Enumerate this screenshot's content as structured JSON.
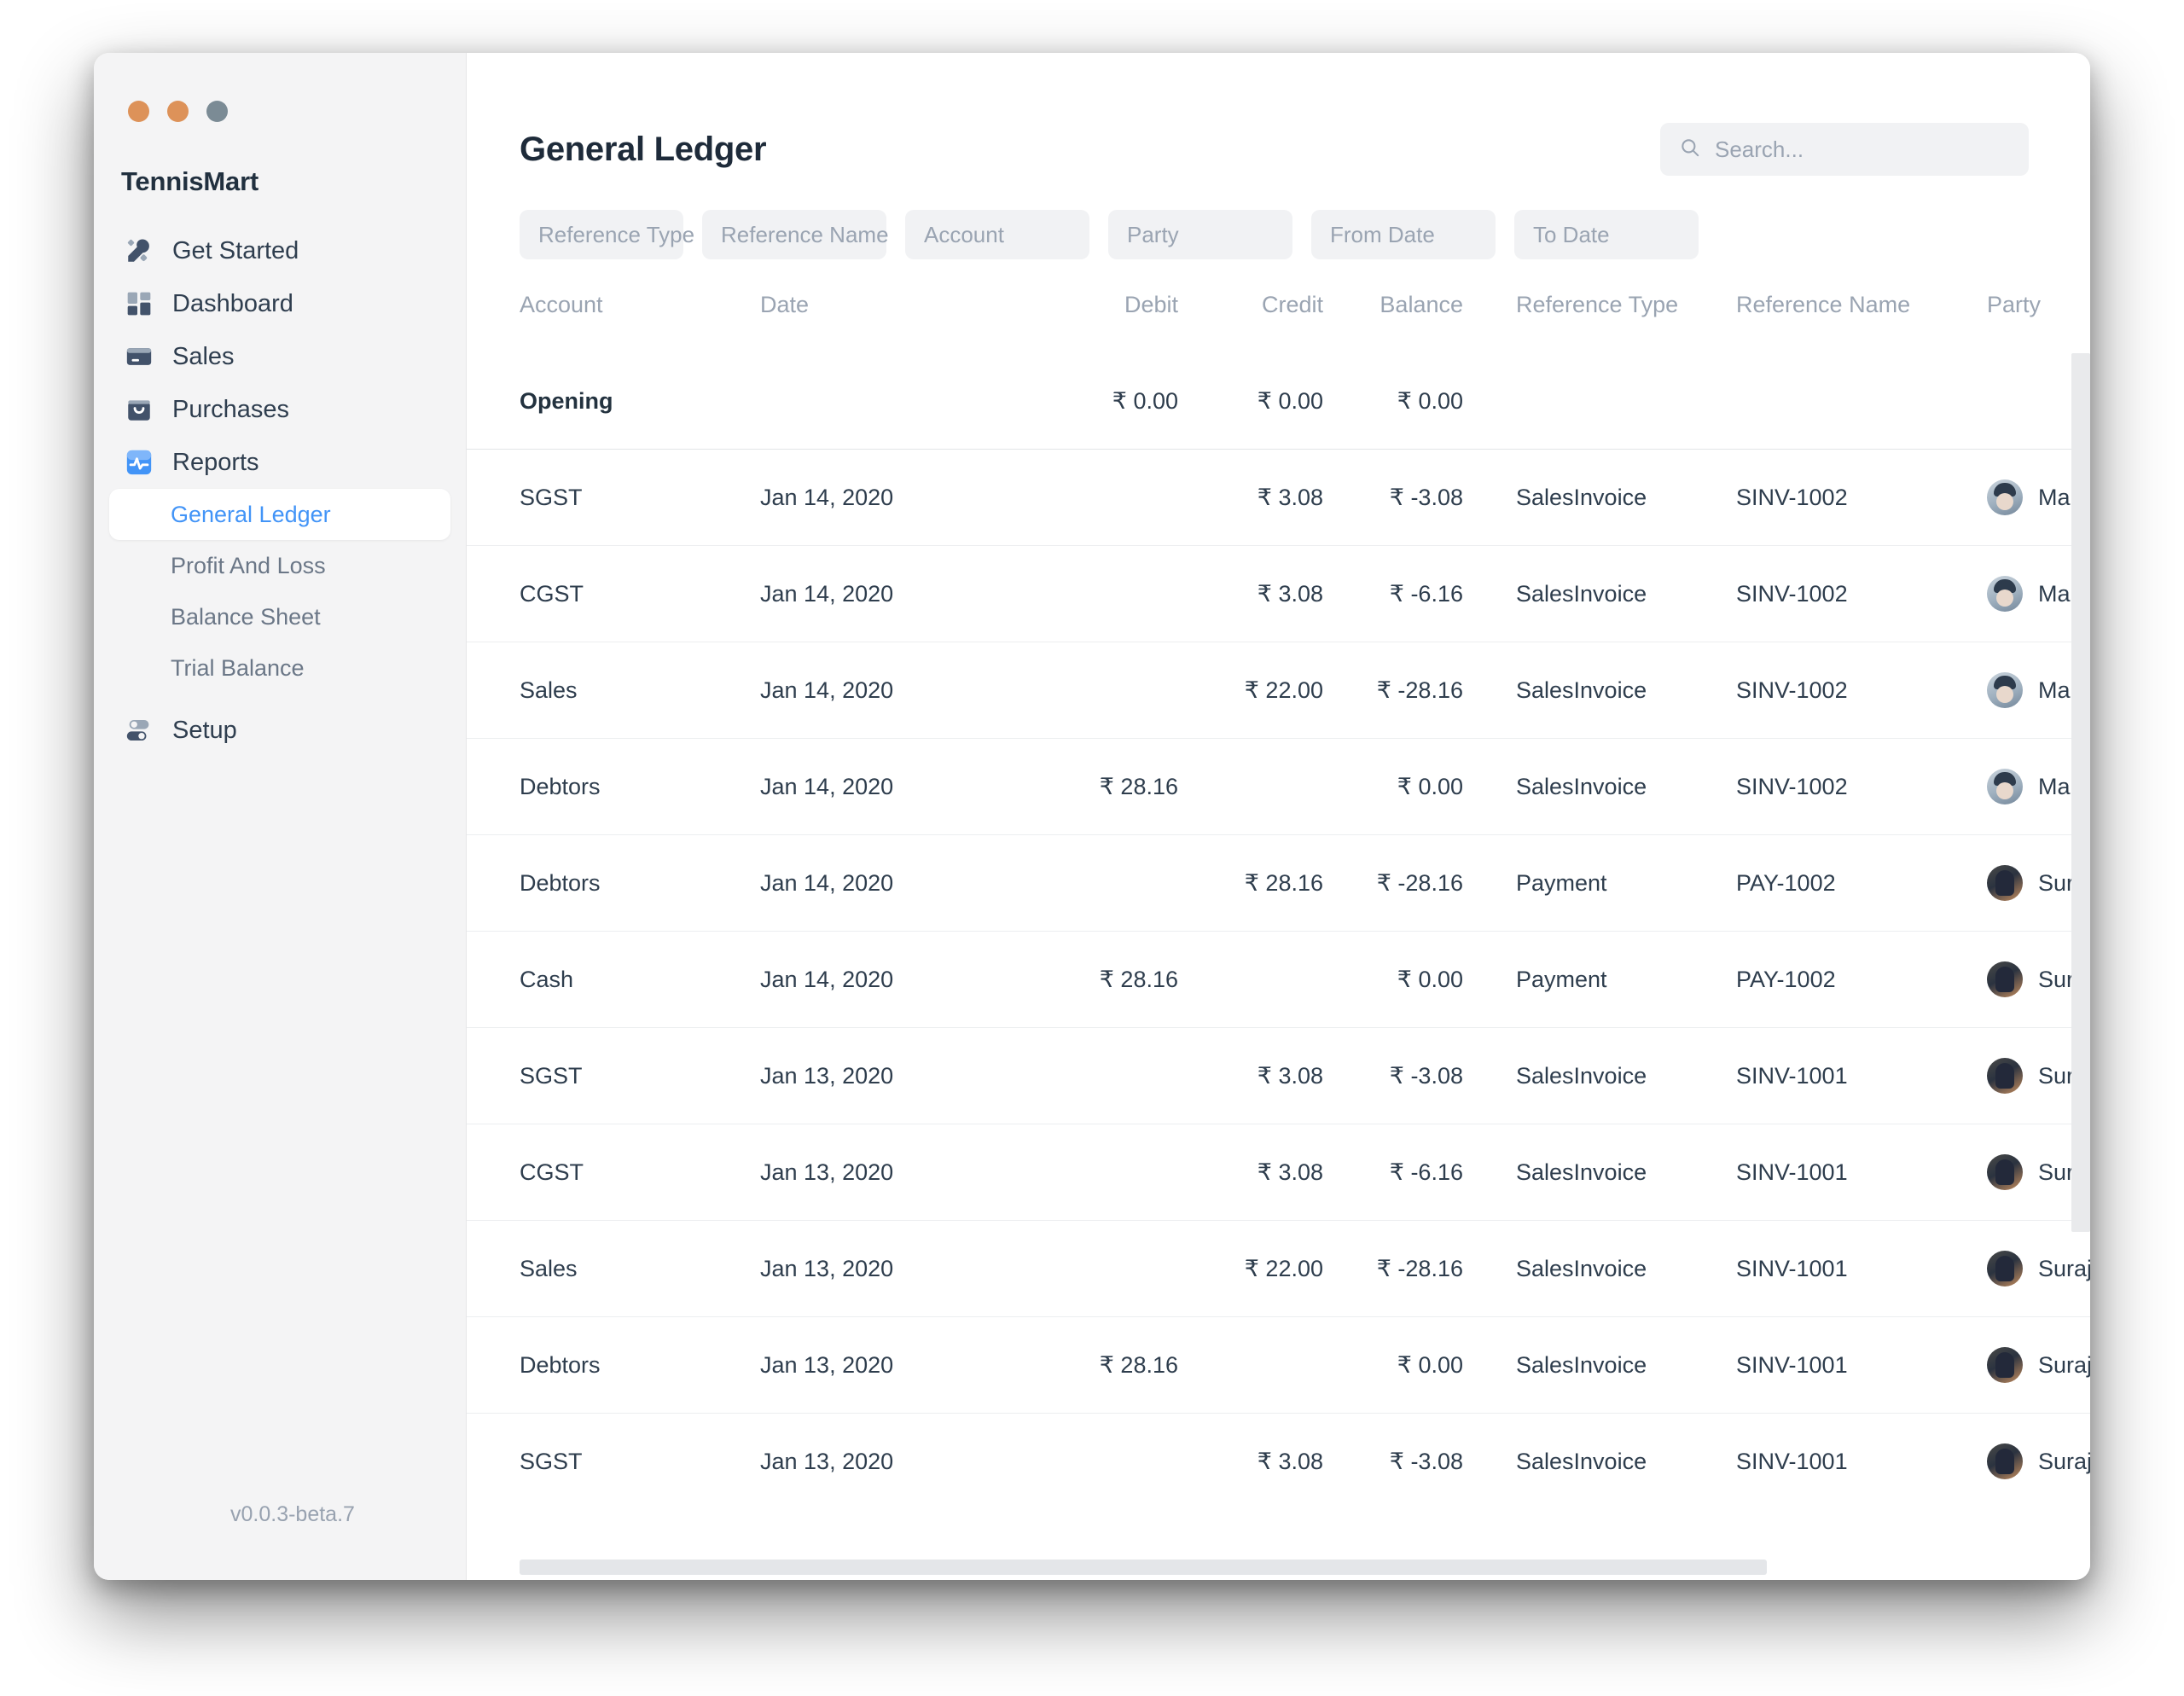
{
  "window": {
    "traffic_lights": [
      "close",
      "minimize",
      "zoom"
    ],
    "colors": {
      "close": "#dd9259",
      "minimize": "#dd9259",
      "zoom": "#7b8b95",
      "accent": "#4294f7"
    }
  },
  "sidebar": {
    "company": "TennisMart",
    "version": "v0.0.3-beta.7",
    "items": [
      {
        "label": "Get Started",
        "icon": "tools-icon"
      },
      {
        "label": "Dashboard",
        "icon": "dashboard-grid-icon"
      },
      {
        "label": "Sales",
        "icon": "card-icon"
      },
      {
        "label": "Purchases",
        "icon": "shopping-bag-icon"
      },
      {
        "label": "Reports",
        "icon": "chart-activity-icon"
      }
    ],
    "reports_children": [
      {
        "label": "General Ledger",
        "active": true
      },
      {
        "label": "Profit And Loss",
        "active": false
      },
      {
        "label": "Balance Sheet",
        "active": false
      },
      {
        "label": "Trial Balance",
        "active": false
      }
    ],
    "setup": {
      "label": "Setup",
      "icon": "toggles-icon"
    }
  },
  "header": {
    "title": "General Ledger",
    "search": {
      "placeholder": "Search...",
      "value": "",
      "icon": "search-icon"
    }
  },
  "filters": [
    {
      "label": "Reference Type",
      "type": "select",
      "has_chevron": true
    },
    {
      "label": "Reference Name",
      "type": "text",
      "has_chevron": false
    },
    {
      "label": "Account",
      "type": "text",
      "has_chevron": false
    },
    {
      "label": "Party",
      "type": "text",
      "has_chevron": false
    },
    {
      "label": "From Date",
      "type": "date",
      "has_chevron": false
    },
    {
      "label": "To Date",
      "type": "date",
      "has_chevron": false
    }
  ],
  "table": {
    "columns": [
      "Account",
      "Date",
      "Debit",
      "Credit",
      "Balance",
      "Reference Type",
      "Reference Name",
      "Party"
    ],
    "opening": {
      "account": "Opening",
      "date": "",
      "debit": "₹ 0.00",
      "credit": "₹ 0.00",
      "balance": "₹ 0.00",
      "reference_type": "",
      "reference_name": "",
      "party": ""
    },
    "rows": [
      {
        "account": "SGST",
        "date": "Jan 14, 2020",
        "debit": "",
        "credit": "₹ 3.08",
        "balance": "₹ -3.08",
        "reference_type": "SalesInvoice",
        "reference_name": "SINV-1002",
        "party": "Maruc",
        "avatar": "maruti"
      },
      {
        "account": "CGST",
        "date": "Jan 14, 2020",
        "debit": "",
        "credit": "₹ 3.08",
        "balance": "₹ -6.16",
        "reference_type": "SalesInvoice",
        "reference_name": "SINV-1002",
        "party": "Maruc",
        "avatar": "maruti"
      },
      {
        "account": "Sales",
        "date": "Jan 14, 2020",
        "debit": "",
        "credit": "₹ 22.00",
        "balance": "₹ -28.16",
        "reference_type": "SalesInvoice",
        "reference_name": "SINV-1002",
        "party": "Maruc",
        "avatar": "maruti"
      },
      {
        "account": "Debtors",
        "date": "Jan 14, 2020",
        "debit": "₹ 28.16",
        "credit": "",
        "balance": "₹ 0.00",
        "reference_type": "SalesInvoice",
        "reference_name": "SINV-1002",
        "party": "Maruc",
        "avatar": "maruti"
      },
      {
        "account": "Debtors",
        "date": "Jan 14, 2020",
        "debit": "",
        "credit": "₹ 28.16",
        "balance": "₹ -28.16",
        "reference_type": "Payment",
        "reference_name": "PAY-1002",
        "party": "Suraj",
        "avatar": "suraj"
      },
      {
        "account": "Cash",
        "date": "Jan 14, 2020",
        "debit": "₹ 28.16",
        "credit": "",
        "balance": "₹ 0.00",
        "reference_type": "Payment",
        "reference_name": "PAY-1002",
        "party": "Suraj",
        "avatar": "suraj"
      },
      {
        "account": "SGST",
        "date": "Jan 13, 2020",
        "debit": "",
        "credit": "₹ 3.08",
        "balance": "₹ -3.08",
        "reference_type": "SalesInvoice",
        "reference_name": "SINV-1001",
        "party": "Suraj",
        "avatar": "suraj"
      },
      {
        "account": "CGST",
        "date": "Jan 13, 2020",
        "debit": "",
        "credit": "₹ 3.08",
        "balance": "₹ -6.16",
        "reference_type": "SalesInvoice",
        "reference_name": "SINV-1001",
        "party": "Suraj",
        "avatar": "suraj"
      },
      {
        "account": "Sales",
        "date": "Jan 13, 2020",
        "debit": "",
        "credit": "₹ 22.00",
        "balance": "₹ -28.16",
        "reference_type": "SalesInvoice",
        "reference_name": "SINV-1001",
        "party": "Suraj",
        "avatar": "suraj"
      },
      {
        "account": "Debtors",
        "date": "Jan 13, 2020",
        "debit": "₹ 28.16",
        "credit": "",
        "balance": "₹ 0.00",
        "reference_type": "SalesInvoice",
        "reference_name": "SINV-1001",
        "party": "Suraj",
        "avatar": "suraj"
      },
      {
        "account": "SGST",
        "date": "Jan 13, 2020",
        "debit": "",
        "credit": "₹ 3.08",
        "balance": "₹ -3.08",
        "reference_type": "SalesInvoice",
        "reference_name": "SINV-1001",
        "party": "Suraj",
        "avatar": "suraj"
      }
    ]
  }
}
